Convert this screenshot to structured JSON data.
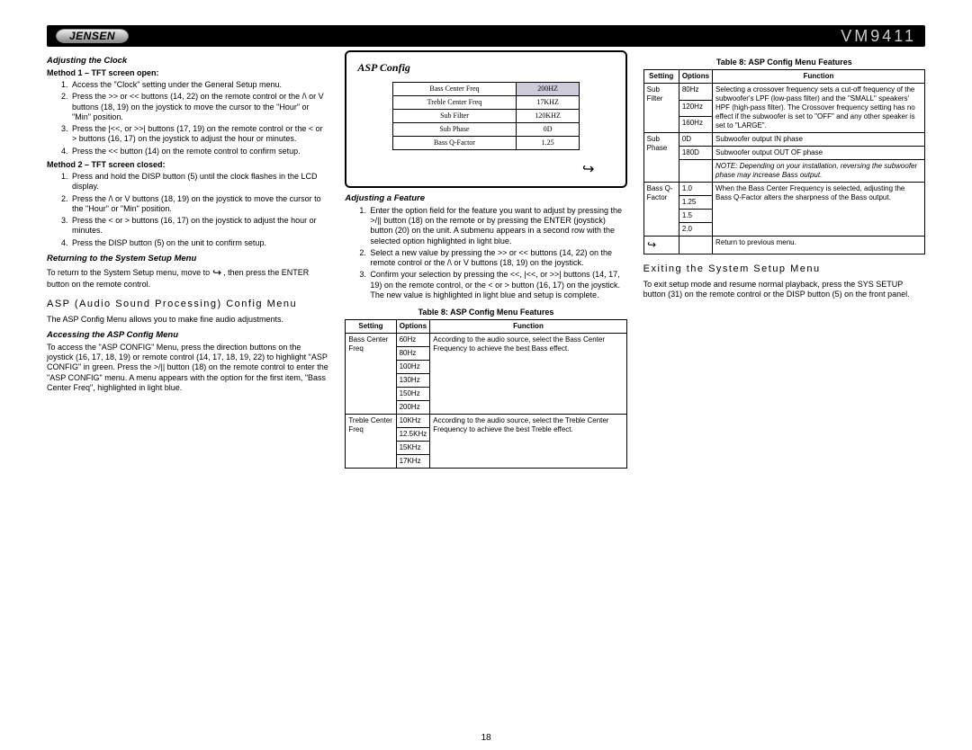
{
  "header": {
    "brand": "JENSEN",
    "model": "VM9411"
  },
  "page_number": "18",
  "col1": {
    "h_adjust_clock": "Adjusting the Clock",
    "h_method1": "Method 1 – TFT screen open:",
    "m1_steps": [
      "Access the \"Clock\" setting under the General Setup menu.",
      "Press the >> or << buttons (14, 22) on the remote control or the /\\ or V buttons (18, 19) on the joystick to move the cursor to the \"Hour\" or \"Min\" position.",
      "Press the |<<, or >>| buttons (17, 19) on the remote control or the < or > buttons (16, 17) on the joystick to adjust the hour or minutes.",
      "Press the << button (14) on the remote control to confirm setup."
    ],
    "h_method2": "Method 2 – TFT screen closed:",
    "m2_steps": [
      "Press and hold the DISP button (5) until the clock flashes in the LCD display.",
      "Press the /\\ or V buttons (18, 19) on the joystick to move the cursor to the \"Hour\" or \"Min\" position.",
      "Press the < or > buttons (16, 17) on the joystick to adjust the hour or minutes.",
      "Press the DISP button (5) on the unit to confirm setup."
    ],
    "h_return": "Returning to the System Setup Menu",
    "return_text_a": "To return to the System Setup menu, move to ",
    "return_text_b": " , then press the ENTER button on the remote control.",
    "h_asp_menu": "ASP (Audio Sound Processing) Config Menu",
    "asp_intro": "The ASP Config Menu allows you to make fine audio adjustments.",
    "h_access": "Accessing the ASP Config Menu",
    "access_text": "To access the \"ASP CONFIG\" Menu, press the direction buttons on the joystick (16, 17, 18, 19) or remote control (14, 17, 18, 19, 22) to highlight \"ASP CONFIG\" in green. Press the >/|| button (18) on the remote control to enter the \"ASP CONFIG\" menu. A menu appears with the option for the first item, \"Bass Center Freq\", highlighted in light blue."
  },
  "col2": {
    "screen_title": "ASP Config",
    "menu_rows": [
      {
        "label": "Bass Center Freq",
        "value": "200HZ",
        "sel": true
      },
      {
        "label": "Treble Center Freq",
        "value": "17KHZ",
        "sel": false
      },
      {
        "label": "Sub Filter",
        "value": "120KHZ",
        "sel": false
      },
      {
        "label": "Sub Phase",
        "value": "0D",
        "sel": false
      },
      {
        "label": "Bass Q-Factor",
        "value": "1.25",
        "sel": false
      }
    ],
    "h_adjust_feature": "Adjusting a Feature",
    "af_steps": [
      "Enter the option field for the feature you want to adjust by pressing the >/|| button (18) on the remote or by pressing the ENTER (joystick) button (20) on the unit. A submenu appears in a second row with the selected option highlighted in light blue.",
      "Select a new value by pressing the >> or << buttons (14, 22) on the remote control or the /\\ or V buttons (18, 19) on the joystick.",
      "Confirm your selection by pressing the <<, |<<, or >>| buttons (14, 17, 19) on the remote control, or the < or > button (16, 17) on the joystick. The new value is highlighted in light blue and setup is complete."
    ],
    "table_caption": "Table 8: ASP Config Menu Features",
    "th_setting": "Setting",
    "th_options": "Options",
    "th_function": "Function",
    "rows": [
      {
        "setting": "Bass Center Freq",
        "opts": [
          "60Hz",
          "80Hz",
          "100Hz",
          "130Hz",
          "150Hz",
          "200Hz"
        ],
        "func": "According to the audio source, select the Bass Center Frequency to achieve the best Bass effect."
      },
      {
        "setting": "Treble Center Freq",
        "opts": [
          "10KHz",
          "12.5KHz",
          "15KHz",
          "17KHz"
        ],
        "func": "According to the audio source, select the Treble Center Frequency to achieve the best Treble effect."
      }
    ]
  },
  "col3": {
    "table_caption": "Table 8: ASP Config Menu Features",
    "th_setting": "Setting",
    "th_options": "Options",
    "th_function": "Function",
    "rows": [
      {
        "setting": "Sub Filter",
        "opts": [
          "80Hz",
          "120Hz",
          "160Hz"
        ],
        "func": "Selecting a crossover frequency sets a cut-off frequency of the subwoofer's LPF (low-pass filter) and the \"SMALL\" speakers' HPF (high-pass filter). The Crossover frequency setting has no effect if the subwoofer is set to \"OFF\" and any other speaker is set to \"LARGE\"."
      },
      {
        "setting": "Sub Phase",
        "opts": [
          "0D",
          "180D"
        ],
        "func_rows": [
          "Subwoofer output IN phase",
          "Subwoofer output OUT OF phase"
        ],
        "note": "NOTE: Depending on your installation, reversing the subwoofer phase may increase Bass output."
      },
      {
        "setting": "Bass Q-Factor",
        "opts": [
          "1.0",
          "1.25",
          "1.5",
          "2.0"
        ],
        "func": "When the Bass Center Frequency is selected, adjusting the Bass Q-Factor alters the sharpness of the Bass output."
      },
      {
        "setting_icon": true,
        "opts": [
          ""
        ],
        "func": "Return to previous menu."
      }
    ],
    "h_exit": "Exiting the System Setup Menu",
    "exit_text": "To exit setup mode and resume normal playback, press the SYS SETUP button (31) on the remote control or the DISP button (5) on the front panel."
  }
}
